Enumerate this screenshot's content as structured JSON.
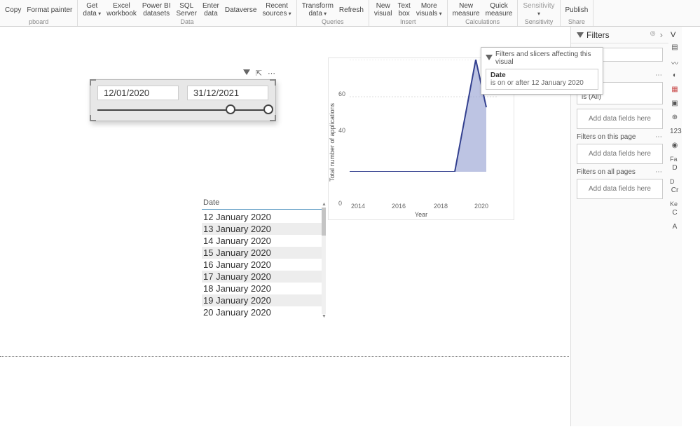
{
  "ribbon": {
    "groups": [
      {
        "buttons": [
          {
            "l1": "Copy",
            "l2": ""
          },
          {
            "l1": "Format painter",
            "l2": ""
          }
        ],
        "label": "pboard"
      },
      {
        "buttons": [
          {
            "l1": "Get",
            "l2": "data",
            "chev": true
          },
          {
            "l1": "Excel",
            "l2": "workbook"
          },
          {
            "l1": "Power BI",
            "l2": "datasets"
          },
          {
            "l1": "SQL",
            "l2": "Server"
          },
          {
            "l1": "Enter",
            "l2": "data"
          },
          {
            "l1": "Dataverse",
            "l2": ""
          },
          {
            "l1": "Recent",
            "l2": "sources",
            "chev": true
          }
        ],
        "label": "Data"
      },
      {
        "buttons": [
          {
            "l1": "Transform",
            "l2": "data",
            "chev": true
          },
          {
            "l1": "Refresh",
            "l2": ""
          }
        ],
        "label": "Queries"
      },
      {
        "buttons": [
          {
            "l1": "New",
            "l2": "visual"
          },
          {
            "l1": "Text",
            "l2": "box"
          },
          {
            "l1": "More",
            "l2": "visuals",
            "chev": true
          }
        ],
        "label": "Insert"
      },
      {
        "buttons": [
          {
            "l1": "New",
            "l2": "measure"
          },
          {
            "l1": "Quick",
            "l2": "measure"
          }
        ],
        "label": "Calculations"
      },
      {
        "buttons": [
          {
            "l1": "Sensitivity",
            "l2": "",
            "chev": true,
            "dim": true
          }
        ],
        "label": "Sensitivity"
      },
      {
        "buttons": [
          {
            "l1": "Publish",
            "l2": ""
          }
        ],
        "label": "Share"
      }
    ]
  },
  "slicer": {
    "from": "12/01/2020",
    "to": "31/12/2021"
  },
  "date_table": {
    "header": "Date",
    "rows": [
      "12 January 2020",
      "13 January 2020",
      "14 January 2020",
      "15 January 2020",
      "16 January 2020",
      "17 January 2020",
      "18 January 2020",
      "19 January 2020",
      "20 January 2020"
    ]
  },
  "chart_data": {
    "type": "area",
    "xlabel": "Year",
    "ylabel": "Total number of applications",
    "x_ticks": [
      "2014",
      "2016",
      "2018",
      "2020"
    ],
    "y_ticks": [
      "0",
      "40",
      "60"
    ],
    "series": [
      {
        "name": "applications",
        "x": [
          2014,
          2015,
          2016,
          2017,
          2018,
          2019,
          2020,
          2020.3
        ],
        "y": [
          0,
          0,
          0,
          0,
          0,
          0,
          60,
          35
        ]
      }
    ],
    "xlim": [
      2014,
      2021
    ],
    "ylim": [
      0,
      60
    ]
  },
  "popover": {
    "title": "Filters and slicers affecting this visual",
    "field": "Date",
    "desc": "is on or after 12 January 2020"
  },
  "filters_pane": {
    "title": "Filters",
    "search_ph": "h",
    "sec_visual": "visual",
    "sec_visual_menu": "...",
    "card_field": "Date",
    "card_desc": "is (All)",
    "add": "Add data fields here",
    "sec_page": "Filters on this page",
    "sec_all": "Filters on all pages"
  },
  "vizpane": {
    "label": "V"
  },
  "rail": {
    "fa": "Fa",
    "d": "D",
    "d2": "D",
    "cr": "Cr",
    "ke": "Ke",
    "c": "C",
    "a": "A",
    "num": "123"
  }
}
